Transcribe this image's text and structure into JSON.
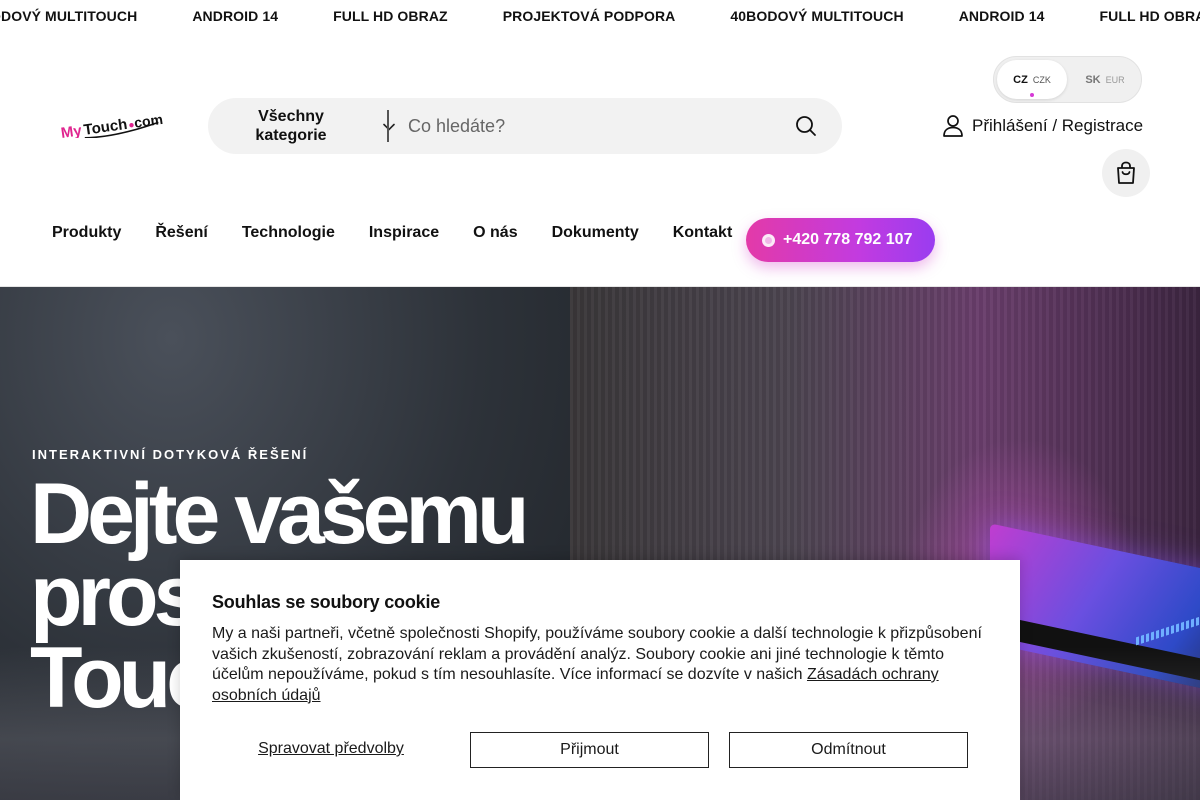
{
  "ticker": {
    "items": [
      "ODOVÝ MULTITOUCH",
      "ANDROID 14",
      "FULL HD OBRAZ",
      "PROJEKTOVÁ PODPORA",
      "40BODOVÝ MULTITOUCH",
      "ANDROID 14",
      "FULL HD OBRA"
    ]
  },
  "header": {
    "logo_text": "MyTouch.com",
    "search": {
      "category_label": "Všechny kategorie",
      "placeholder": "Co hledáte?"
    },
    "currency": {
      "active": {
        "code": "CZ",
        "unit": "CZK"
      },
      "inactive": {
        "code": "SK",
        "unit": "EUR"
      }
    },
    "account_label": "Přihlášení / Registrace"
  },
  "nav": {
    "items": [
      "Produkty",
      "Řešení",
      "Technologie",
      "Inspirace",
      "O nás",
      "Dokumenty",
      "Kontakt"
    ],
    "phone": "+420 778 792 107"
  },
  "hero": {
    "eyebrow": "INTERAKTIVNÍ DOTYKOVÁ ŘEŠENÍ",
    "title_line1": "Dejte vašemu",
    "title_line2": "pros",
    "title_line3": "Touc"
  },
  "cookie": {
    "title": "Souhlas se soubory cookie",
    "text": "My a naši partneři, včetně společnosti Shopify, používáme soubory cookie a další technologie k přizpůsobení vašich zkušeností, zobrazování reklam a provádění analýz. Soubory cookie ani jiné technologie k těmto účelům nepoužíváme, pokud s tím nesouhlasíte. Více informací se dozvíte v našich",
    "link": "Zásadách ochrany osobních údajů",
    "manage": "Spravovat předvolby",
    "accept": "Přijmout",
    "decline": "Odmítnout"
  },
  "colors": {
    "accent_pink": "#e33aa8",
    "accent_purple": "#9a3cf0"
  }
}
